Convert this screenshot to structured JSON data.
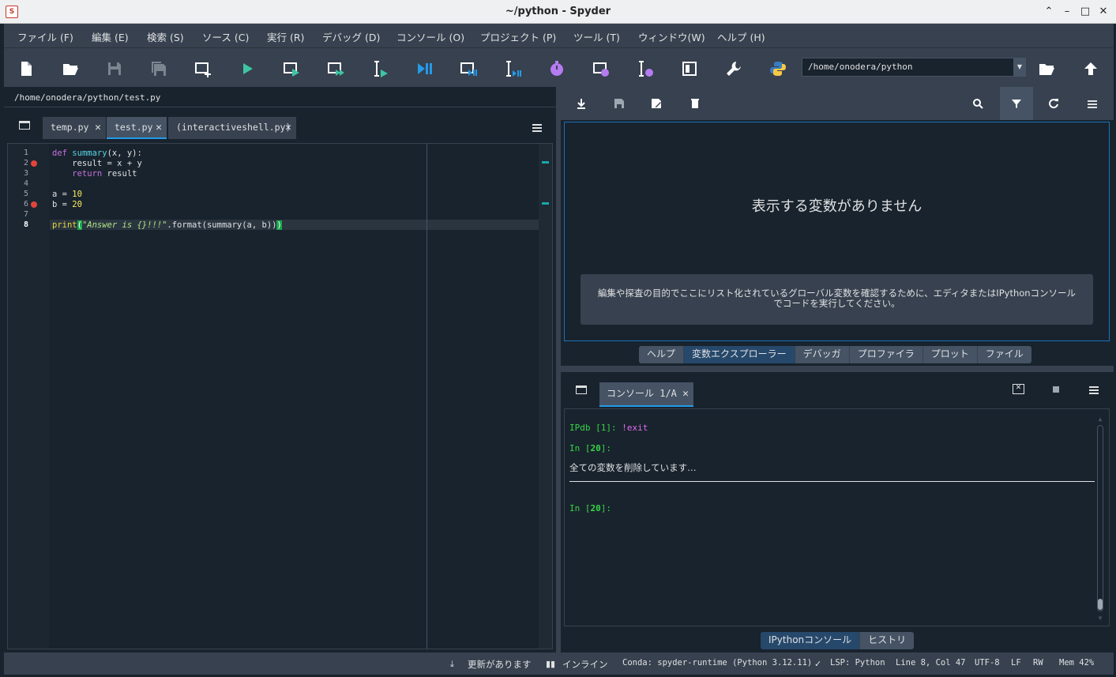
{
  "window": {
    "title": "~/python - Spyder"
  },
  "menu": [
    "ファイル (F)",
    "編集 (E)",
    "検索 (S)",
    "ソース (C)",
    "実行 (R)",
    "デバッグ (D)",
    "コンソール (O)",
    "プロジェクト (P)",
    "ツール (T)",
    "ウィンドウ(W)",
    "ヘルプ (H)"
  ],
  "toolbar": {
    "working_dir": "/home/onodera/python"
  },
  "editor": {
    "file_path": "/home/onodera/python/test.py",
    "tabs": [
      "temp.py",
      "test.py",
      "(interactiveshell.py)"
    ],
    "active_tab": "test.py",
    "breakpoint_lines": [
      2,
      6
    ],
    "current_line": 8,
    "line_numbers": [
      "1",
      "2",
      "3",
      "4",
      "5",
      "6",
      "7",
      "8"
    ],
    "code": {
      "l1_def": "def",
      "l1_name": "summary",
      "l1_rest": "(x, y):",
      "l2": "    result = x + y",
      "l3_kw": "    return",
      "l3_rest": " result",
      "l5_pre": "a = ",
      "l5_num": "10",
      "l6_pre": "b = ",
      "l6_num": "20",
      "l8_print": "print",
      "l8_open": "(",
      "l8_str": "\"Answer is {}!!!\"",
      "l8_mid": ".format(summary(a, b))",
      "l8_close": ")"
    }
  },
  "variable_explorer": {
    "empty_title": "表示する変数がありません",
    "empty_help": "編集や探査の目的でここにリスト化されているグローバル変数を確認するために、エディタまたはIPythonコンソールでコードを実行してください。",
    "tabs": [
      "ヘルプ",
      "変数エクスプローラー",
      "デバッガ",
      "プロファイラ",
      "プロット",
      "ファイル"
    ],
    "active_tab": "変数エクスプローラー"
  },
  "console": {
    "tab_label": "コンソール 1/A",
    "lines": {
      "ipdb_prompt": "IPdb [1]:",
      "ipdb_cmd": " !exit",
      "in_prompt_1_pre": "In [",
      "in_prompt_1_num": "20",
      "in_prompt_1_post": "]:",
      "message": "全ての変数を削除しています…",
      "in_prompt_2_pre": "In [",
      "in_prompt_2_num": "20",
      "in_prompt_2_post": "]:"
    },
    "tabs": [
      "IPythonコンソール",
      "ヒストリ"
    ],
    "active_tab": "IPythonコンソール"
  },
  "status": {
    "update": "更新があります",
    "inline": "インライン",
    "conda": "Conda: spyder-runtime (Python 3.12.11)",
    "lsp": "LSP: Python",
    "position": "Line 8, Col 47",
    "encoding": "UTF-8",
    "eol": "LF",
    "rw": "RW",
    "mem": "Mem 42%"
  },
  "colors": {
    "accent": "#259ae9",
    "run_green": "#3fc5a4",
    "debug_blue": "#259ae9",
    "profile_purple": "#b57cf0",
    "breakpoint": "#e2453a"
  }
}
